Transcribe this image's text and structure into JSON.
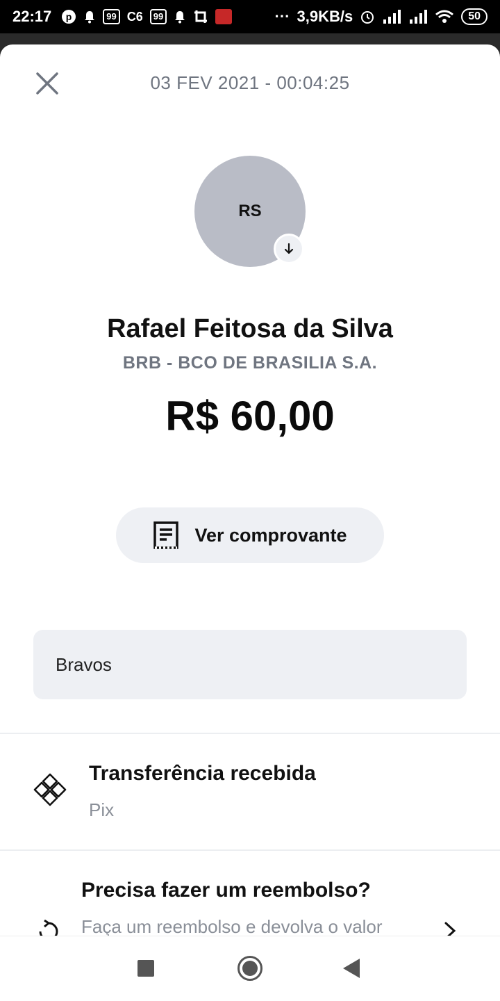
{
  "status_bar": {
    "time": "22:17",
    "notif_box_1": "99",
    "notif_c6": "C6",
    "notif_box_2": "99",
    "dots": "···",
    "net_speed": "3,9KB/s",
    "battery": "50"
  },
  "header": {
    "datetime": "03 FEV 2021 - 00:04:25"
  },
  "contact": {
    "initials": "RS",
    "name": "Rafael Feitosa da Silva",
    "bank": "BRB - BCO DE BRASILIA S.A.",
    "amount": "R$ 60,00"
  },
  "receipt_button": {
    "label": "Ver comprovante"
  },
  "message": {
    "text": "Bravos"
  },
  "transaction": {
    "title": "Transferência recebida",
    "subtitle": "Pix"
  },
  "refund": {
    "title": "Precisa fazer um reembolso?",
    "subtitle": "Faça um reembolso e devolva o valor"
  },
  "colors": {
    "accent_gray": "#eef0f4",
    "avatar": "#b9bcc6",
    "muted_text": "#6f7580"
  }
}
